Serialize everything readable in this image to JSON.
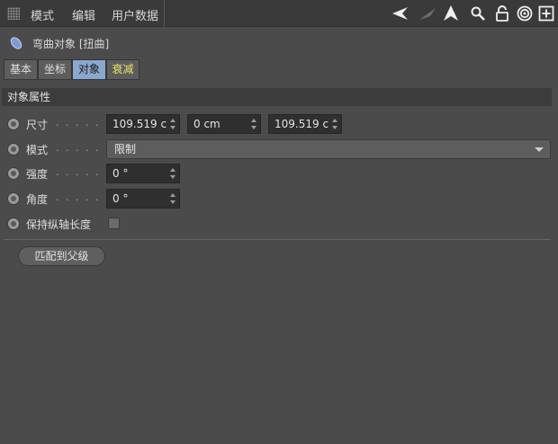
{
  "menubar": {
    "items": [
      "模式",
      "编辑",
      "用户数据"
    ],
    "icons": [
      "back-arrow-icon",
      "forward-arrow-icon",
      "up-arrow-icon",
      "search-icon",
      "lock-icon",
      "target-icon",
      "add-icon"
    ]
  },
  "object": {
    "title": "弯曲对象 [扭曲]"
  },
  "tabs": [
    {
      "label": "基本"
    },
    {
      "label": "坐标"
    },
    {
      "label": "对象",
      "active": true
    },
    {
      "label": "衰减"
    }
  ],
  "section": {
    "title": "对象属性"
  },
  "rows": {
    "size": {
      "label": "尺寸",
      "dots": ". . . . . . .",
      "values": [
        "109.519 c",
        "0 cm",
        "109.519 c"
      ]
    },
    "mode": {
      "label": "模式",
      "dots": ". . . . . . .",
      "value": "限制"
    },
    "strength": {
      "label": "强度",
      "dots": ". . . . . . .",
      "value": "0 °"
    },
    "angle": {
      "label": "角度",
      "dots": ". . . . . . .",
      "value": "0 °"
    },
    "keep_length": {
      "label": "保持纵轴长度",
      "checked": false
    }
  },
  "buttons": {
    "match_parent": "匹配到父级"
  },
  "colors": {
    "background": "#4b4b4b",
    "menubar": "#3a3a3a",
    "active_tab": "#8aa7cf",
    "falloff_tab_text": "#e8e26a"
  }
}
